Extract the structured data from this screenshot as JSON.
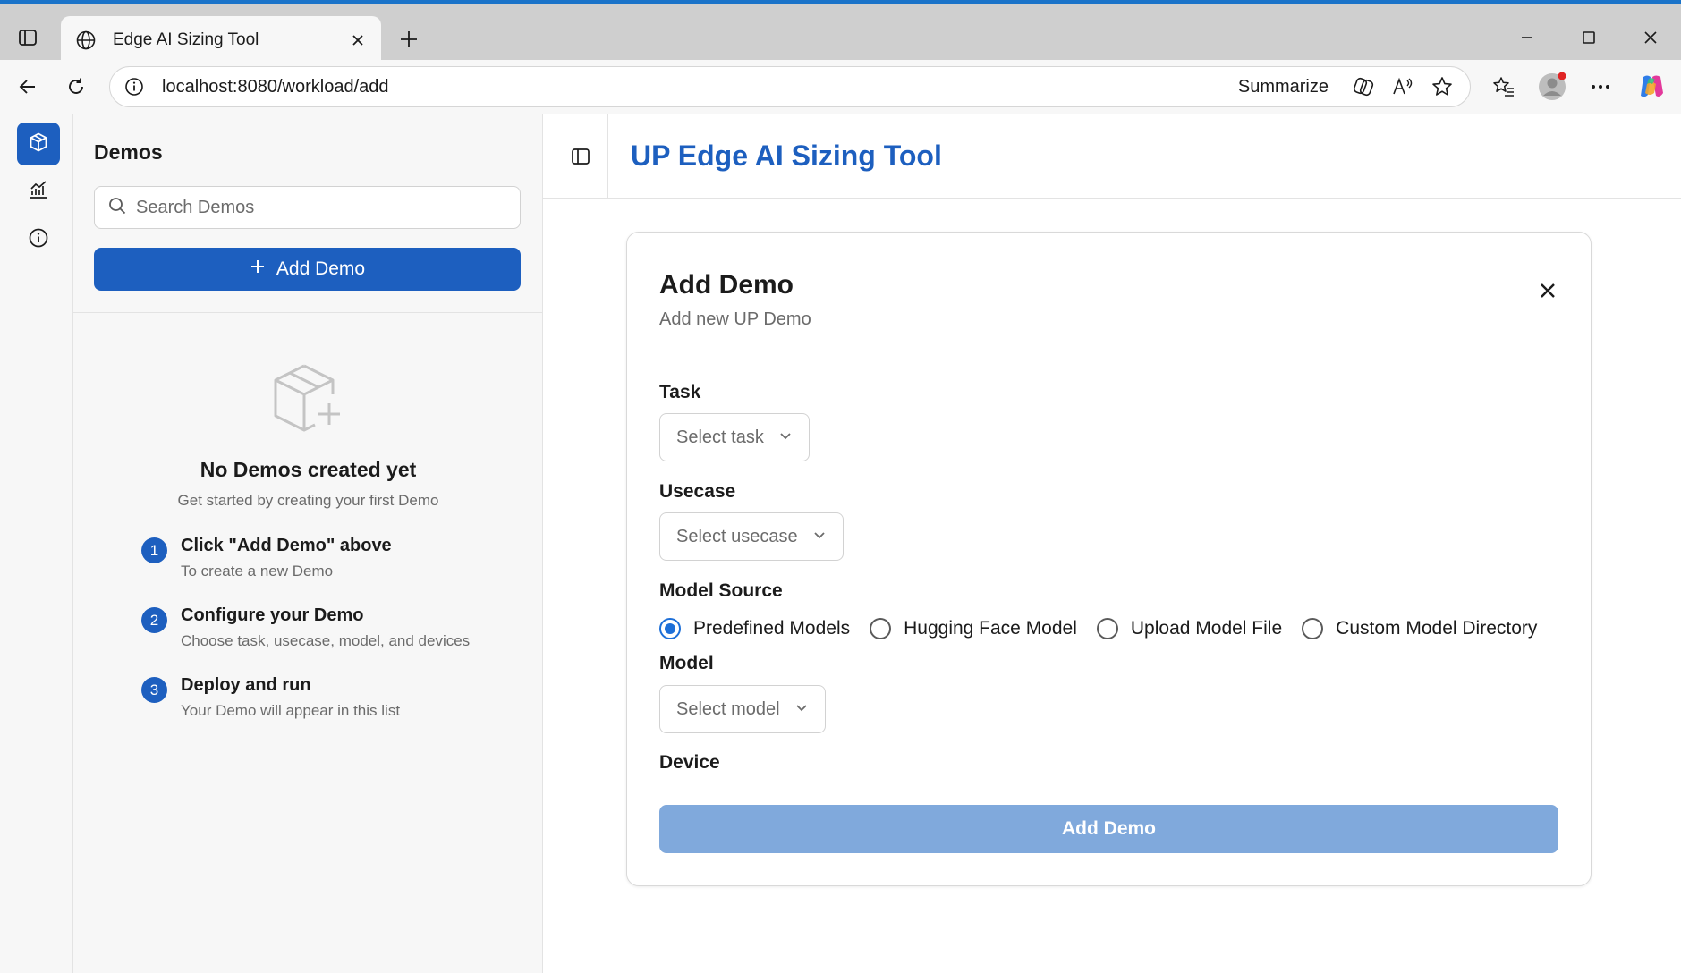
{
  "browser": {
    "tab_title": "Edge AI Sizing Tool",
    "url": "localhost:8080/workload/add",
    "summarize_label": "Summarize"
  },
  "sidebar": {
    "title": "Demos",
    "search_placeholder": "Search Demos",
    "add_button": "Add Demo",
    "empty_title": "No Demos created yet",
    "empty_subtitle": "Get started by creating your first Demo",
    "steps": [
      {
        "number": "1",
        "title": "Click \"Add Demo\" above",
        "desc": "To create a new Demo"
      },
      {
        "number": "2",
        "title": "Configure your Demo",
        "desc": "Choose task, usecase, model, and devices"
      },
      {
        "number": "3",
        "title": "Deploy and run",
        "desc": "Your Demo will appear in this list"
      }
    ]
  },
  "header": {
    "title": "UP Edge AI Sizing Tool"
  },
  "form": {
    "title": "Add Demo",
    "subtitle": "Add new UP Demo",
    "task_label": "Task",
    "task_placeholder": "Select task",
    "usecase_label": "Usecase",
    "usecase_placeholder": "Select usecase",
    "model_source_label": "Model Source",
    "model_sources": [
      {
        "label": "Predefined Models",
        "checked": true
      },
      {
        "label": "Hugging Face Model",
        "checked": false
      },
      {
        "label": "Upload Model File",
        "checked": false
      },
      {
        "label": "Custom Model Directory",
        "checked": false
      }
    ],
    "model_label": "Model",
    "model_placeholder": "Select model",
    "device_label": "Device",
    "submit_label": "Add Demo"
  },
  "colors": {
    "primary": "#1d5fbf",
    "primary_disabled": "#80a9dc",
    "radio_checked": "#1d6fd8",
    "browser_accent": "#1a73c9"
  },
  "icons": {
    "rail": [
      "cube-icon",
      "analytics-icon",
      "info-icon"
    ]
  }
}
